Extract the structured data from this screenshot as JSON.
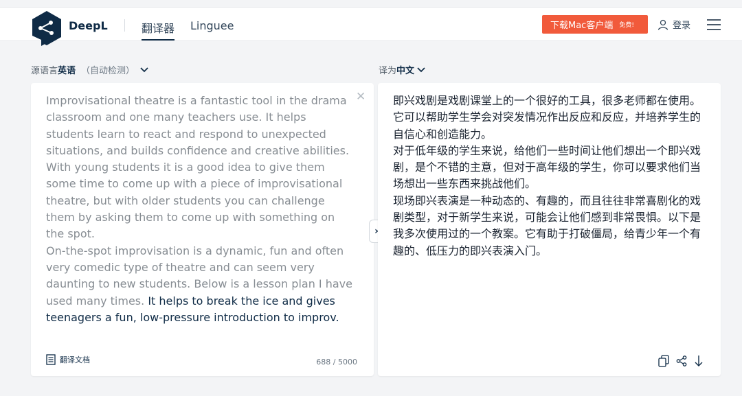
{
  "header": {
    "brand": "DeepL",
    "tabs": [
      {
        "label": "翻译器",
        "active": true
      },
      {
        "label": "Linguee",
        "active": false
      }
    ],
    "download_button": {
      "label": "下载Mac客户端",
      "badge": "免费!"
    },
    "login_label": "登录"
  },
  "source": {
    "label_prefix": "源语言",
    "language": "英语",
    "auto_detect": "（自动检测）",
    "paragraphs": [
      "Improvisational theatre is a fantastic tool in the drama classroom and one many teachers use. It helps students learn to react and respond to unexpected situations, and builds confidence and creative abilities.",
      "With young students it is a good idea to give them some time to come up with a piece of improvisational theatre, but with older students you can challenge them by asking them to come up with something on the spot."
    ],
    "last_paragraph_plain": "On-the-spot improvisation is a dynamic, fun and often very comedic type of theatre and can seem very daunting to new students. Below is a lesson plan I have used many times. ",
    "last_paragraph_highlight": "It helps to break the ice and gives teenagers a fun, low-pressure introduction to improv.",
    "document_button": "翻译文档",
    "char_count": "688 / 5000"
  },
  "target": {
    "label_prefix": "译为",
    "language": "中文",
    "paragraphs": [
      "即兴戏剧是戏剧课堂上的一个很好的工具，很多老师都在使用。它可以帮助学生学会对突发情况作出反应和反应，并培养学生的自信心和创造能力。",
      "对于低年级的学生来说，给他们一些时间让他们想出一个即兴戏剧，是个不错的主意，但对于高年级的学生，你可以要求他们当场想出一些东西来挑战他们。",
      "现场即兴表演是一种动态的、有趣的，而且往往非常喜剧化的戏剧类型，对于新学生来说，可能会让他们感到非常畏惧。以下是我多次使用过的一个教案。它有助于打破僵局，给青少年一个有趣的、低压力的即兴表演入门。"
    ]
  },
  "colors": {
    "brand_navy": "#0f2b46",
    "download_orange": "#f15a3b",
    "source_gray": "#878d93"
  }
}
